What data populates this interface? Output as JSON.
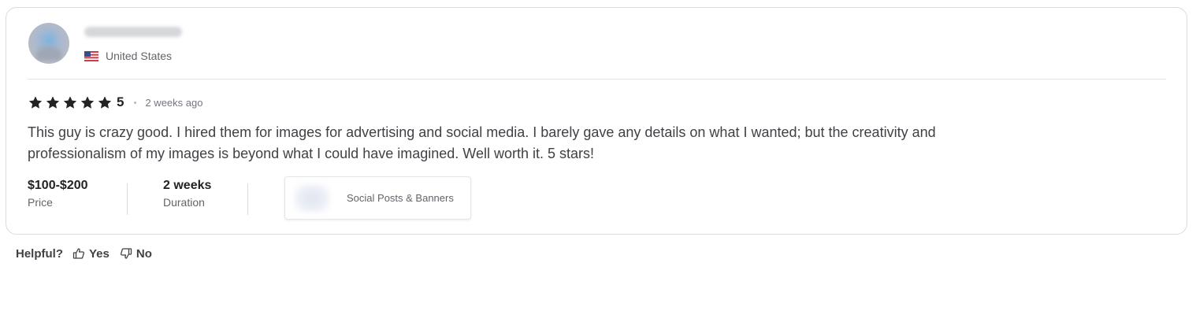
{
  "reviewer": {
    "country": "United States",
    "flag_icon": "us-flag-icon",
    "username_blurred": true
  },
  "rating": {
    "stars": 5,
    "score_label": "5",
    "time_ago": "2 weeks ago",
    "star_color": "#222325"
  },
  "review": {
    "text": "This guy is crazy good. I hired them for images for advertising and social media. I barely gave any details on what I wanted; but the creativity and professionalism of my images is beyond what I could have imagined. Well worth it. 5 stars!"
  },
  "meta": {
    "price_value": "$100-$200",
    "price_label": "Price",
    "duration_value": "2 weeks",
    "duration_label": "Duration"
  },
  "gig": {
    "title": "Social Posts & Banners"
  },
  "helpful": {
    "label": "Helpful?",
    "yes_label": "Yes",
    "no_label": "No",
    "yes_icon": "thumbs-up-icon",
    "no_icon": "thumbs-down-icon"
  },
  "colors": {
    "text_primary": "#222325",
    "text_body": "#404145",
    "text_muted": "#62646a",
    "border": "#dadbdd"
  }
}
